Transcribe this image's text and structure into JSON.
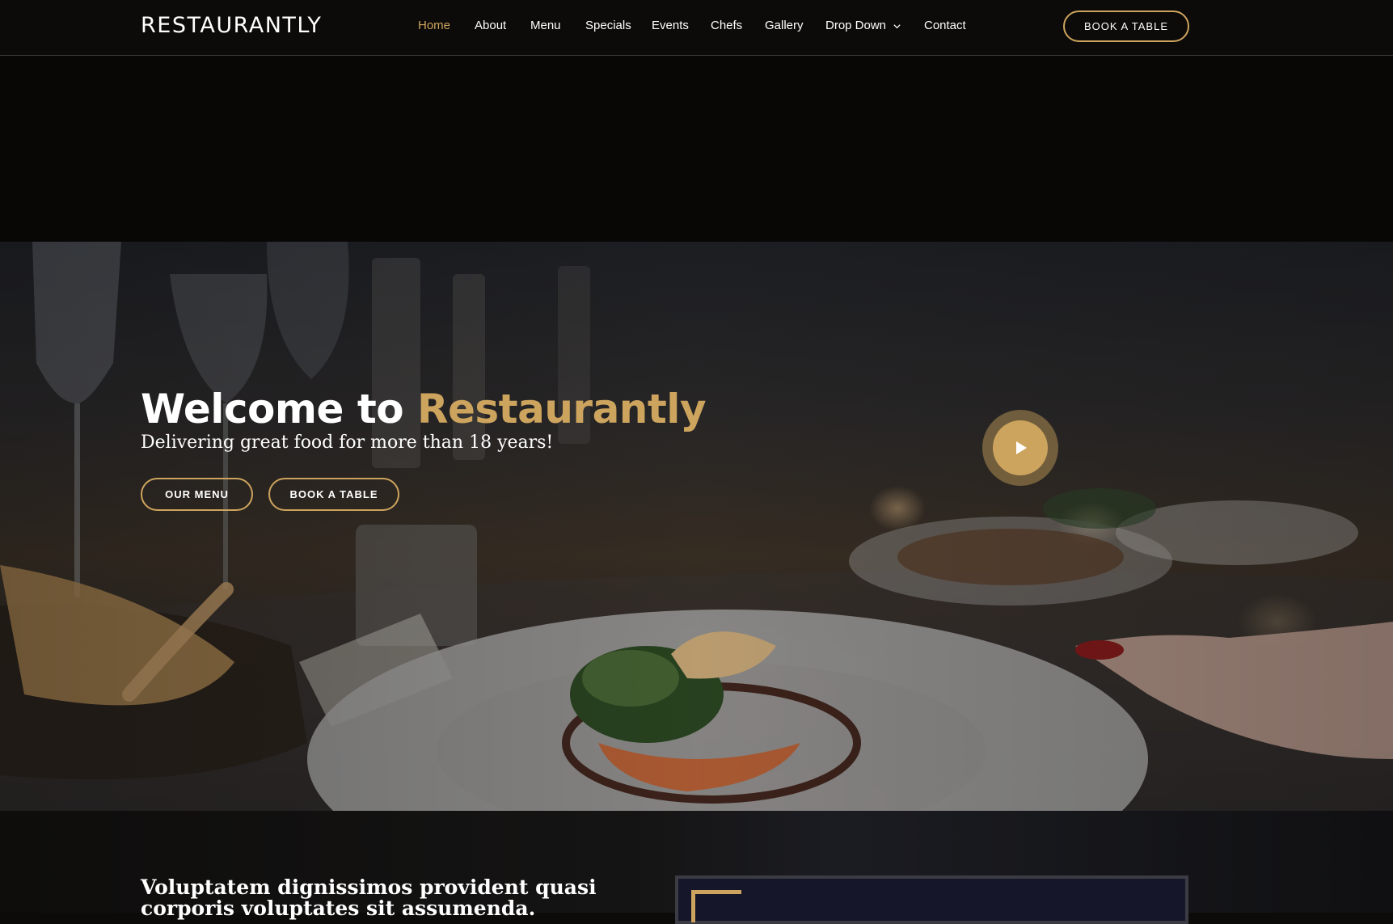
{
  "header": {
    "logo": "RESTAURANTLY",
    "nav": [
      {
        "label": "Home",
        "active": true
      },
      {
        "label": "About"
      },
      {
        "label": "Menu"
      },
      {
        "label": "Specials"
      },
      {
        "label": "Events"
      },
      {
        "label": "Chefs"
      },
      {
        "label": "Gallery"
      },
      {
        "label": "Drop Down",
        "icon": "chevron-down-icon"
      },
      {
        "label": "Contact"
      }
    ],
    "book_button": "BOOK A TABLE"
  },
  "hero": {
    "title_prefix": "Welcome to",
    "title_accent": "Restaurantly",
    "subtitle": "Delivering great food for more than 18 years!",
    "menu_button": "OUR MENU",
    "book_button": "BOOK A TABLE",
    "play_icon": "play-icon"
  },
  "about": {
    "title": "Voluptatem dignissimos provident quasi corporis voluptates sit assumenda."
  },
  "colors": {
    "accent": "#cda45e",
    "background": "#0c0b09",
    "text": "#ffffff"
  }
}
